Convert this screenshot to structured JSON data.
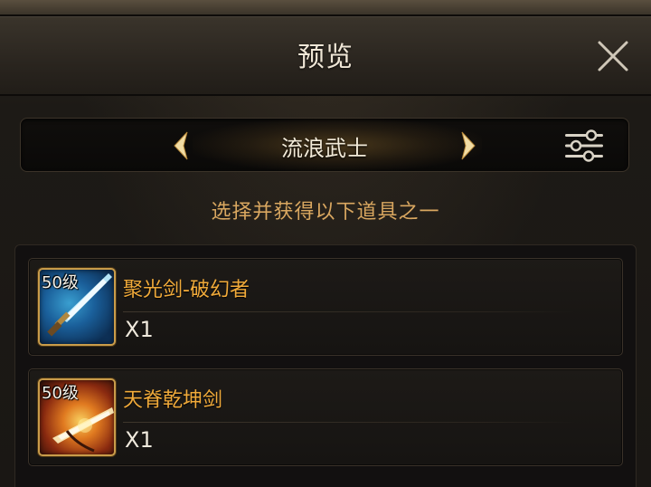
{
  "header": {
    "title": "预览",
    "close_icon": "close-icon"
  },
  "selector": {
    "current": "流浪武士",
    "prev_icon": "chevron-left-icon",
    "next_icon": "chevron-right-icon",
    "filter_icon": "sliders-icon"
  },
  "subtitle": "选择并获得以下道具之一",
  "items": [
    {
      "level": "50级",
      "name": "聚光剑-破幻者",
      "quantity": "X1",
      "icon": "blue-sword-icon"
    },
    {
      "level": "50级",
      "name": "天脊乾坤剑",
      "quantity": "X1",
      "icon": "flame-sword-icon"
    }
  ],
  "colors": {
    "accent_gold": "#d9a760",
    "item_name": "#f0aa3a",
    "frame_gold": "#c99c4a",
    "background": "#1a1714"
  }
}
